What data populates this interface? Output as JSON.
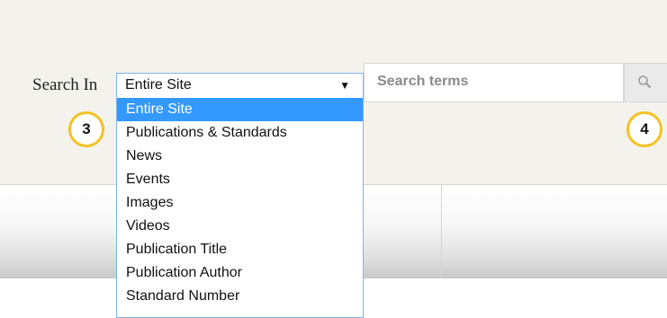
{
  "search": {
    "label": "Search In",
    "scope_selected": "Entire Site",
    "scope_arrow": "▼",
    "placeholder": "Search terms",
    "button_icon": "magnifier-icon"
  },
  "dropdown": {
    "options": [
      "Entire Site",
      "Publications & Standards",
      "News",
      "Events",
      "Images",
      "Videos",
      "Publication Title",
      "Publication Author",
      "Standard Number"
    ],
    "selected_index": 0
  },
  "callouts": {
    "left": "3",
    "right": "4"
  },
  "colors": {
    "background_band": "#f4f2ec",
    "highlight": "#3399ff",
    "callout_ring": "#f3c224",
    "select_border": "#7eb4ea"
  }
}
